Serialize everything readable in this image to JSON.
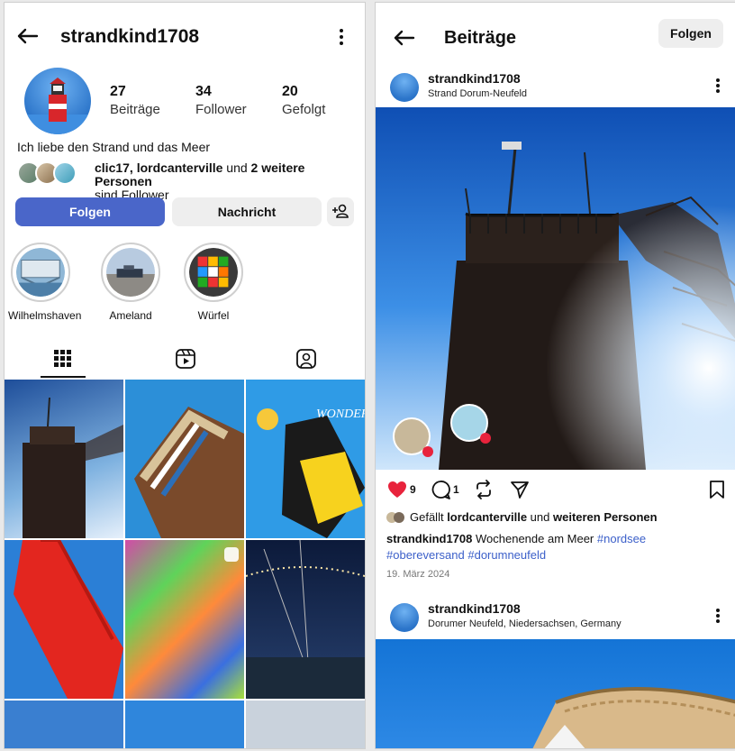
{
  "profile": {
    "username": "strandkind1708",
    "stats": {
      "posts_value": "27",
      "posts_label": "Beiträge",
      "followers_value": "34",
      "followers_label": "Follower",
      "following_value": "20",
      "following_label": "Gefolgt"
    },
    "bio": "Ich liebe den Strand und das Meer",
    "followed_by": {
      "names": "clic17, lordcanterville",
      "connector": " und ",
      "others": "2 weitere Personen",
      "suffix": "sind Follower"
    },
    "buttons": {
      "follow": "Folgen",
      "message": "Nachricht"
    },
    "highlights": [
      {
        "label": "Wilhelmshaven"
      },
      {
        "label": "Ameland"
      },
      {
        "label": "Würfel"
      }
    ],
    "tabs": [
      "grid-icon",
      "reels-icon",
      "tagged-icon"
    ]
  },
  "feed": {
    "title": "Beiträge",
    "follow_label": "Folgen",
    "post1": {
      "username": "strandkind1708",
      "location": "Strand Dorum-Neufeld",
      "likes": "9",
      "comments": "1",
      "liked_prefix": "Gefällt ",
      "liked_name": "lordcanterville",
      "liked_connector": " und ",
      "liked_others": "weiteren Personen",
      "caption_user": "strandkind1708",
      "caption_text": " Wochenende am Meer ",
      "hashtag1": "#nordsee",
      "hashtag2": "#obereversand",
      "hashtag3": "#dorumneufeld",
      "date": "19. März 2024"
    },
    "post2": {
      "username": "strandkind1708",
      "location": "Dorumer Neufeld, Niedersachsen, Germany"
    }
  },
  "colors": {
    "accent": "#4a66c9",
    "like": "#e8233c",
    "hashtag": "#3b5fc9"
  }
}
